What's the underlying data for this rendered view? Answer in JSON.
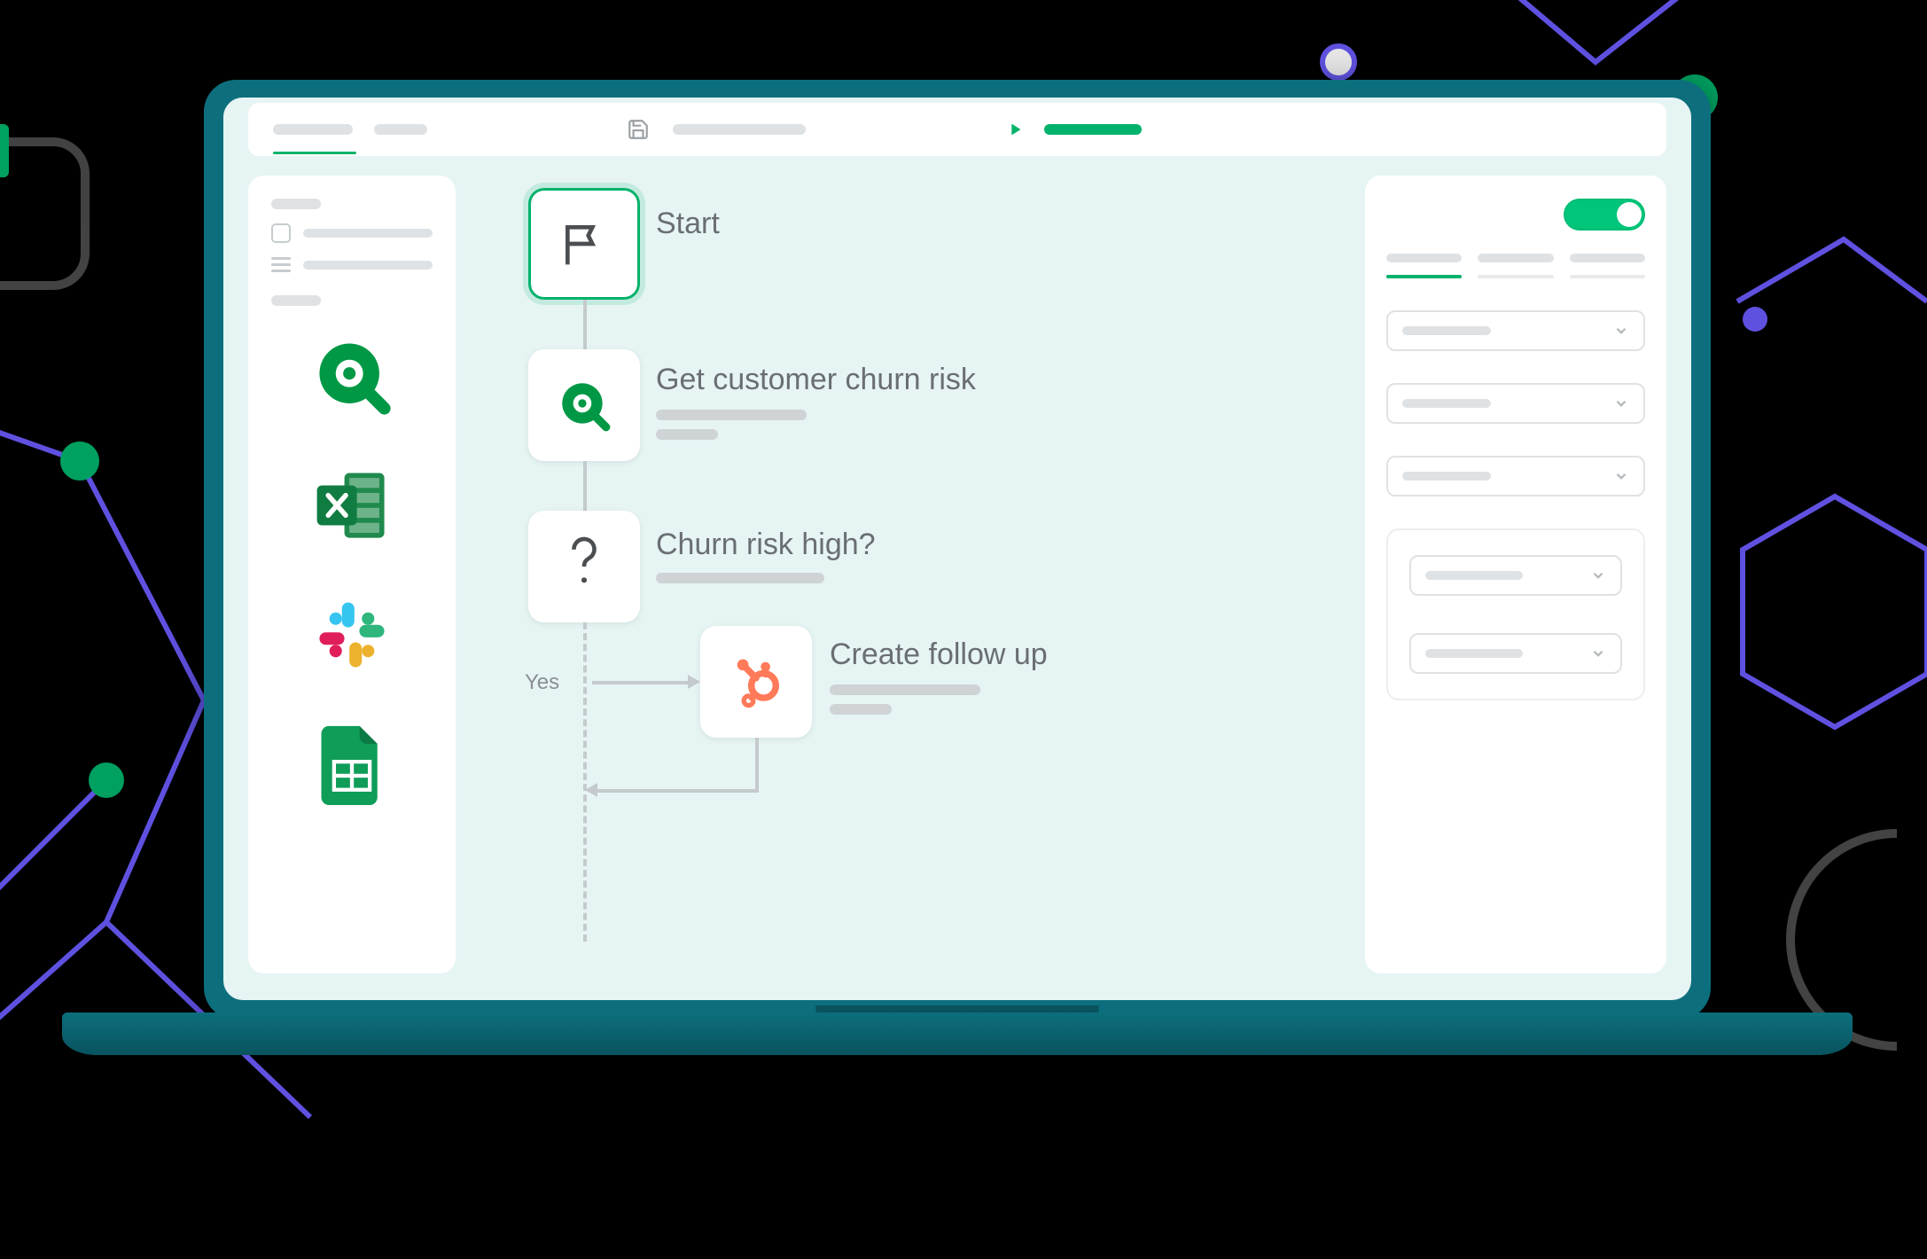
{
  "topbar": {
    "tab1": "",
    "tab2": "",
    "save_icon": "save-icon",
    "play_icon": "play-icon"
  },
  "sidebar": {
    "view_checkbox": false,
    "integrations": [
      {
        "name": "Qlik",
        "icon": "qlik-icon"
      },
      {
        "name": "Excel",
        "icon": "excel-icon"
      },
      {
        "name": "Slack",
        "icon": "slack-icon"
      },
      {
        "name": "Google Sheets",
        "icon": "google-sheets-icon"
      }
    ]
  },
  "flow": {
    "nodes": [
      {
        "id": "start",
        "label": "Start",
        "icon": "flag-icon",
        "type": "start"
      },
      {
        "id": "get",
        "label": "Get customer churn risk",
        "icon": "qlik-icon",
        "type": "action"
      },
      {
        "id": "cond",
        "label": "Churn risk high?",
        "icon": "question-icon",
        "type": "condition"
      },
      {
        "id": "followup",
        "label": "Create follow up",
        "icon": "hubspot-icon",
        "type": "action"
      }
    ],
    "branch_label": "Yes"
  },
  "right": {
    "enabled": true,
    "selects": [
      "",
      "",
      ""
    ],
    "nested_selects": [
      "",
      ""
    ]
  }
}
